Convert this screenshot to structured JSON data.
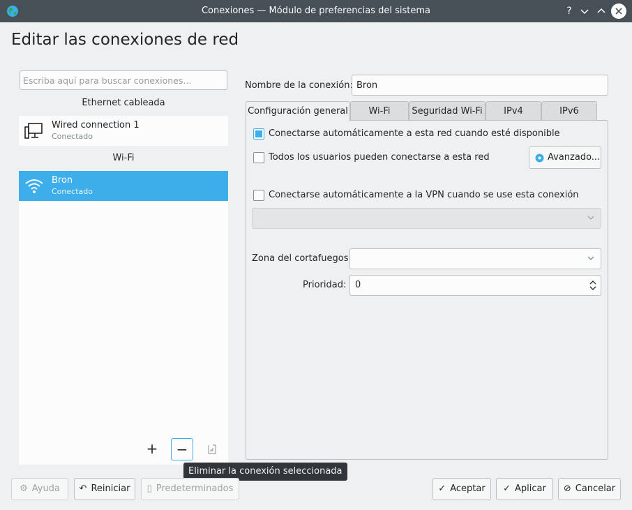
{
  "window": {
    "title": "Conexiones — Módulo de preferencias del sistema",
    "app_icon": "globe-network-icon",
    "controls": [
      "help-icon",
      "minimize-icon",
      "maximize-icon",
      "close-icon"
    ]
  },
  "page": {
    "title": "Editar las conexiones de red"
  },
  "search": {
    "placeholder": "Escriba aquí para buscar conexiones..."
  },
  "connections": {
    "sections": [
      {
        "header": "Ethernet cableada",
        "items": [
          {
            "name": "Wired connection 1",
            "status": "Conectado",
            "icon": "wired-network-icon",
            "selected": false
          }
        ]
      },
      {
        "header": "Wi-Fi",
        "items": [
          {
            "name": "Bron",
            "status": "Conectado",
            "icon": "wifi-icon",
            "selected": true
          }
        ]
      }
    ],
    "actions": {
      "add": "+",
      "remove": "−",
      "export_icon": "export-icon"
    },
    "tooltip": "Eliminar la conexión seleccionada"
  },
  "editor": {
    "name_label": "Nombre de la conexión:",
    "name_value": "Bron",
    "tabs": [
      "Configuración general",
      "Wi-Fi",
      "Seguridad Wi-Fi",
      "IPv4",
      "IPv6"
    ],
    "active_tab": "Configuración general",
    "general": {
      "auto_connect": {
        "label": "Conectarse automáticamente a esta red cuando esté disponible",
        "checked": true
      },
      "all_users": {
        "label": "Todos los usuarios pueden conectarse a esta red",
        "checked": false
      },
      "advanced_button": "Avanzado...",
      "auto_vpn": {
        "label": "Conectarse automáticamente a la VPN cuando se use esta conexión",
        "checked": false
      },
      "vpn_select_value": "",
      "firewall_label": "Zona del cortafuegos:",
      "firewall_value": "",
      "priority_label": "Prioridad:",
      "priority_value": "0"
    }
  },
  "footer": {
    "help": "Ayuda",
    "reset": "Reiniciar",
    "defaults": "Predeterminados",
    "ok": "Aceptar",
    "apply": "Aplicar",
    "cancel": "Cancelar"
  },
  "colors": {
    "accent": "#3daee9",
    "titlebar": "#475057",
    "window_bg": "#eff0f1",
    "tooltip_bg": "#31363b"
  }
}
